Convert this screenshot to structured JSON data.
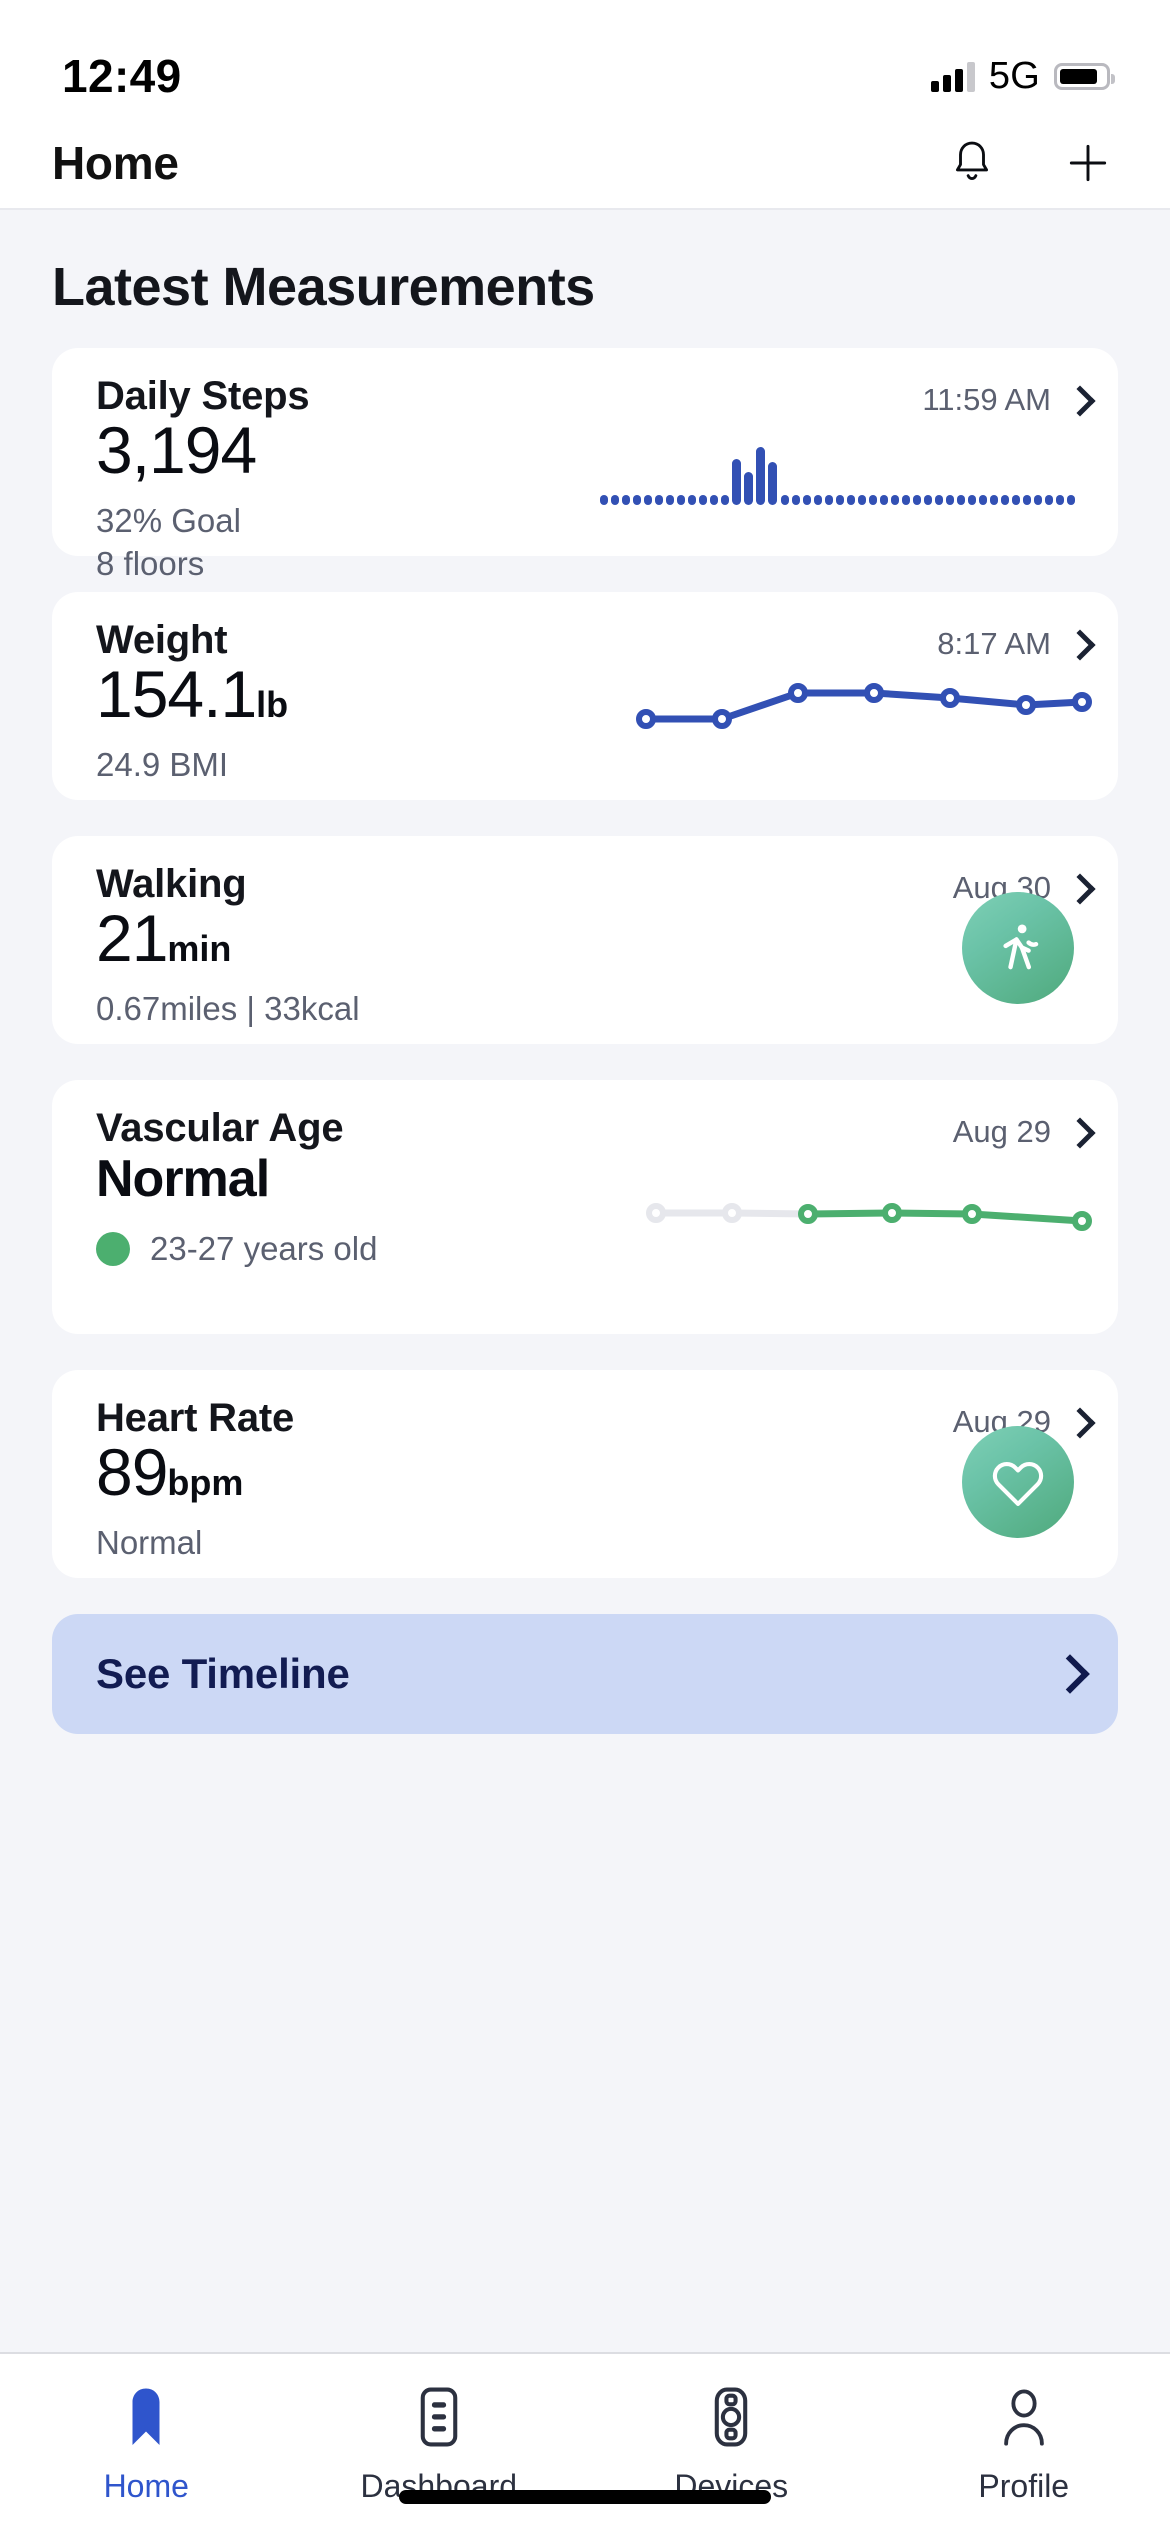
{
  "status_bar": {
    "time": "12:49",
    "network": "5G",
    "signal_icon": "signal-bars-icon",
    "battery_icon": "battery-icon"
  },
  "header": {
    "title": "Home",
    "notifications_icon": "bell-icon",
    "add_icon": "plus-icon"
  },
  "main": {
    "section_title": "Latest Measurements",
    "cards": [
      {
        "name": "Daily Steps",
        "value": "3,194",
        "unit": "",
        "sub_line1": "32% Goal",
        "sub_line2": "8 floors",
        "date": "11:59 AM",
        "chevron_icon": "chevron-right-icon",
        "graph": "steps-bar-sparkline"
      },
      {
        "name": "Weight",
        "value": "154.1",
        "unit": "lb",
        "sub_line1": "24.9 BMI",
        "sub_line2": "",
        "date": "8:17 AM",
        "chevron_icon": "chevron-right-icon",
        "graph": "weight-line-sparkline"
      },
      {
        "name": "Walking",
        "value": "21",
        "unit": "min",
        "sub_line1": "0.67miles | 33kcal",
        "sub_line2": "",
        "date": "Aug 30",
        "chevron_icon": "chevron-right-icon",
        "graph": "walking-badge-icon"
      },
      {
        "name": "Vascular Age",
        "value": "Normal",
        "unit": "",
        "sub_line1": "23-27 years old",
        "sub_line2": "",
        "date": "Aug 29",
        "chevron_icon": "chevron-right-icon",
        "graph": "vascular-line-sparkline",
        "status_dot_color": "#4caf6f"
      },
      {
        "name": "Heart Rate",
        "value": "89",
        "unit": "bpm",
        "sub_line1": "Normal",
        "sub_line2": "",
        "date": "Aug 29",
        "chevron_icon": "chevron-right-icon",
        "graph": "heart-badge-icon"
      }
    ],
    "timeline_button": {
      "label": "See Timeline",
      "chevron_icon": "chevron-right-icon",
      "background_color": "#ccd8f5",
      "text_color": "#121c52"
    }
  },
  "tab_bar": {
    "active_color": "#2f55cc",
    "items": [
      {
        "label": "Home",
        "icon": "home-pin-icon",
        "active": true
      },
      {
        "label": "Dashboard",
        "icon": "dashboard-list-icon",
        "active": false
      },
      {
        "label": "Devices",
        "icon": "watch-device-icon",
        "active": false
      },
      {
        "label": "Profile",
        "icon": "person-icon",
        "active": false
      }
    ]
  },
  "chart_data": [
    {
      "type": "bar",
      "title": "Daily Steps sparkline",
      "series_color": "#3250b4",
      "categories": [
        "1",
        "2",
        "3",
        "4",
        "5",
        "6",
        "7",
        "8",
        "9",
        "10",
        "11",
        "12",
        "13",
        "14",
        "15",
        "16",
        "17",
        "18",
        "19",
        "20",
        "21",
        "22",
        "23",
        "24",
        "25",
        "26",
        "27",
        "28",
        "29",
        "30",
        "31",
        "32",
        "33",
        "34",
        "35",
        "36",
        "37",
        "38",
        "39",
        "40",
        "41",
        "42",
        "43"
      ],
      "values": [
        0,
        0,
        0,
        0,
        0,
        0,
        0,
        0,
        0,
        0,
        0,
        0,
        66,
        38,
        100,
        56,
        0,
        0,
        0,
        0,
        0,
        0,
        0,
        0,
        0,
        0,
        0,
        0,
        0,
        0,
        0,
        0,
        0,
        0,
        0,
        0,
        0,
        0,
        0,
        0,
        0,
        0,
        0
      ],
      "ylim": [
        0,
        100
      ],
      "grid": false,
      "legend": "none"
    },
    {
      "type": "line",
      "title": "Weight sparkline",
      "series_color": "#3250b4",
      "x": [
        1,
        2,
        3,
        4,
        5,
        6,
        7
      ],
      "values": [
        18,
        18,
        68,
        68,
        58,
        48,
        50
      ],
      "ylim": [
        0,
        100
      ],
      "grid": false,
      "legend": "none"
    },
    {
      "type": "line",
      "title": "Vascular Age sparkline",
      "series": [
        {
          "name": "inactive",
          "color": "#e6e7ec",
          "x": [
            1,
            2,
            3
          ],
          "values": [
            50,
            50,
            52
          ]
        },
        {
          "name": "normal",
          "color": "#4caf6f",
          "x": [
            3,
            4,
            5,
            6
          ],
          "values": [
            52,
            50,
            52,
            42
          ]
        }
      ],
      "ylim": [
        0,
        100
      ],
      "grid": false,
      "legend": "none"
    }
  ]
}
